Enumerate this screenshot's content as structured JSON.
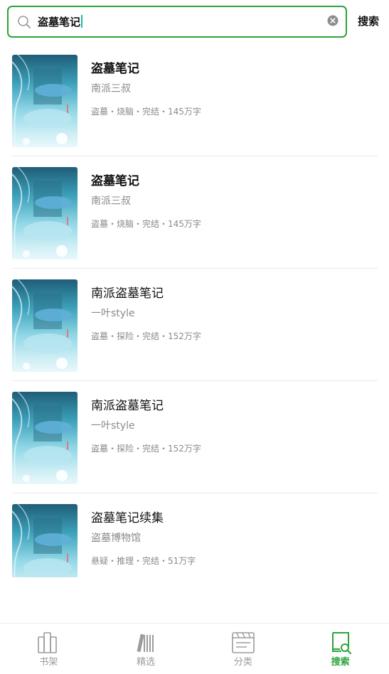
{
  "search": {
    "query": "盗墓笔记",
    "button_label": "搜索"
  },
  "results": [
    {
      "title": "盗墓笔记",
      "author": "南派三叔",
      "meta": "盗墓・烧脑・完结・145万字",
      "bold": true
    },
    {
      "title": "盗墓笔记",
      "author": "南派三叔",
      "meta": "盗墓・烧脑・完结・145万字",
      "bold": true
    },
    {
      "title": "南派盗墓笔记",
      "author": "一叶style",
      "meta": "盗墓・探险・完结・152万字",
      "bold": false
    },
    {
      "title": "南派盗墓笔记",
      "author": "一叶style",
      "meta": "盗墓・探险・完结・152万字",
      "bold": false
    },
    {
      "title": "盗墓笔记续集",
      "author": "盗墓博物馆",
      "meta": "悬疑・推理・完结・51万字",
      "bold": false
    }
  ],
  "bottom_nav": {
    "items": [
      {
        "label": "书架",
        "icon": "bookshelf-icon",
        "active": false
      },
      {
        "label": "精选",
        "icon": "featured-icon",
        "active": false
      },
      {
        "label": "分类",
        "icon": "category-icon",
        "active": false
      },
      {
        "label": "搜索",
        "icon": "search-book-icon",
        "active": true
      }
    ]
  },
  "colors": {
    "accent": "#2aa43a",
    "caret": "#1abc9c",
    "muted_text": "#8a8a8a"
  }
}
